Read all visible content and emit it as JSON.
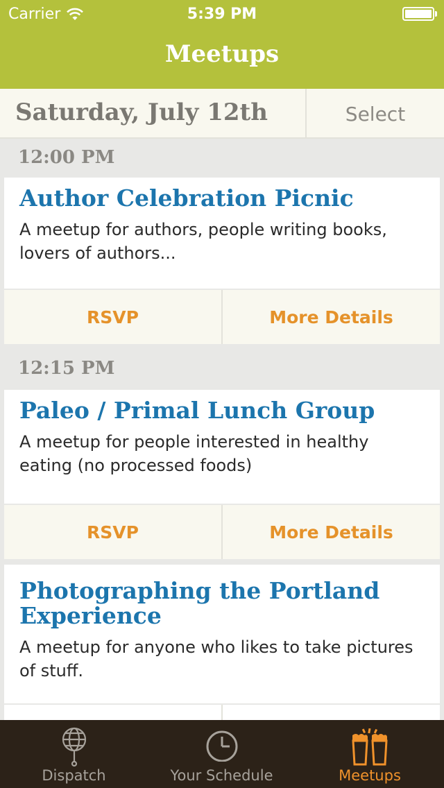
{
  "status_bar": {
    "carrier": "Carrier",
    "time": "5:39 PM"
  },
  "nav": {
    "title": "Meetups"
  },
  "date_header": {
    "date": "Saturday, July 12th",
    "select_label": "Select"
  },
  "groups": [
    {
      "time": "12:00 PM",
      "title": "Author Celebration Picnic",
      "description": "A meetup for authors, people writing books, lovers of authors...",
      "rsvp_label": "RSVP",
      "details_label": "More Details"
    },
    {
      "time": "12:15 PM",
      "title": "Paleo / Primal Lunch Group",
      "description": "A meetup for people interested in healthy eating (no processed foods)",
      "rsvp_label": "RSVP",
      "details_label": "More Details"
    },
    {
      "title": "Photographing the Portland Experience",
      "description": "A meetup for anyone who likes to take pictures of stuff."
    }
  ],
  "tabs": [
    {
      "label": "Dispatch",
      "icon": "globe-icon",
      "active": false
    },
    {
      "label": "Your Schedule",
      "icon": "clock-icon",
      "active": false
    },
    {
      "label": "Meetups",
      "icon": "beer-mugs-icon",
      "active": true
    }
  ],
  "colors": {
    "nav_bar": "#b4c13c",
    "title_blue": "#1c75ad",
    "action_orange": "#e5922a",
    "tab_bar": "#2c2218",
    "tab_active": "#f0922b"
  }
}
